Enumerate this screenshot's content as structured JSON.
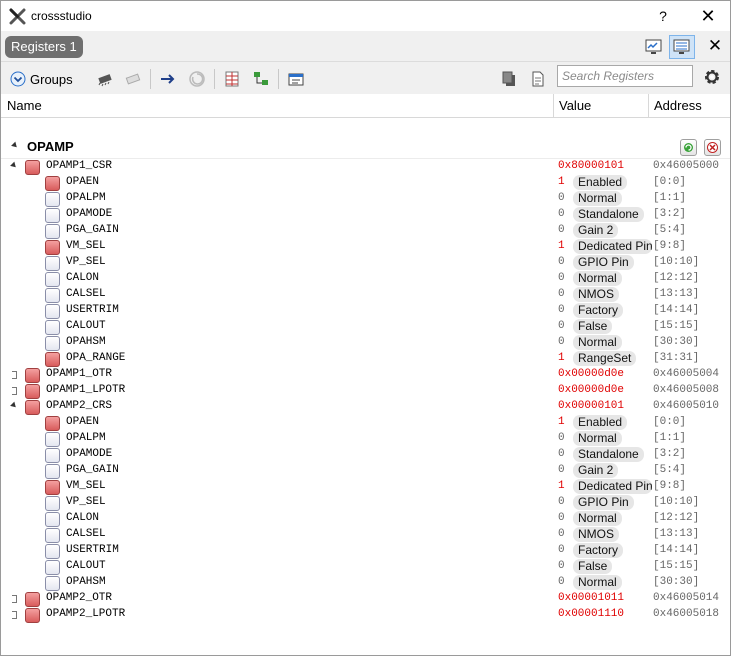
{
  "window": {
    "title": "crossstudio",
    "help_label": "?",
    "close_label": "✕"
  },
  "tabbar": {
    "tab_label": "Registers 1",
    "close_label": "✕"
  },
  "toolbar": {
    "groups_label": "Groups",
    "search_placeholder": "Search Registers"
  },
  "columns": {
    "name": "Name",
    "value": "Value",
    "address": "Address"
  },
  "group": {
    "name": "OPAMP"
  },
  "colors": {
    "register_value": "#e00000",
    "checked_box": "#d85c5c",
    "pill_bg": "#e6e6e6"
  },
  "rows": [
    {
      "level": 0,
      "expander": "open",
      "checked": true,
      "name": "OPAMP1_CSR",
      "value": "0x80000101",
      "value_color": "red",
      "field": "",
      "address": "0x46005000"
    },
    {
      "level": 1,
      "expander": "none",
      "checked": true,
      "name": "OPAEN",
      "value": "1",
      "value_color": "red",
      "field": "Enabled",
      "address": "[0:0]"
    },
    {
      "level": 1,
      "expander": "none",
      "checked": false,
      "name": "OPALPM",
      "value": "0",
      "value_color": "gray",
      "field": "Normal",
      "address": "[1:1]"
    },
    {
      "level": 1,
      "expander": "none",
      "checked": false,
      "name": "OPAMODE",
      "value": "0",
      "value_color": "gray",
      "field": "Standalone",
      "address": "[3:2]"
    },
    {
      "level": 1,
      "expander": "none",
      "checked": false,
      "name": "PGA_GAIN",
      "value": "0",
      "value_color": "gray",
      "field": "Gain 2",
      "address": "[5:4]"
    },
    {
      "level": 1,
      "expander": "none",
      "checked": true,
      "name": "VM_SEL",
      "value": "1",
      "value_color": "red",
      "field": "Dedicated Pin",
      "address": "[9:8]"
    },
    {
      "level": 1,
      "expander": "none",
      "checked": false,
      "name": "VP_SEL",
      "value": "0",
      "value_color": "gray",
      "field": "GPIO Pin",
      "address": "[10:10]"
    },
    {
      "level": 1,
      "expander": "none",
      "checked": false,
      "name": "CALON",
      "value": "0",
      "value_color": "gray",
      "field": "Normal",
      "address": "[12:12]"
    },
    {
      "level": 1,
      "expander": "none",
      "checked": false,
      "name": "CALSEL",
      "value": "0",
      "value_color": "gray",
      "field": "NMOS",
      "address": "[13:13]"
    },
    {
      "level": 1,
      "expander": "none",
      "checked": false,
      "name": "USERTRIM",
      "value": "0",
      "value_color": "gray",
      "field": "Factory",
      "address": "[14:14]"
    },
    {
      "level": 1,
      "expander": "none",
      "checked": false,
      "name": "CALOUT",
      "value": "0",
      "value_color": "gray",
      "field": "False",
      "address": "[15:15]"
    },
    {
      "level": 1,
      "expander": "none",
      "checked": false,
      "name": "OPAHSM",
      "value": "0",
      "value_color": "gray",
      "field": "Normal",
      "address": "[30:30]"
    },
    {
      "level": 1,
      "expander": "none",
      "checked": true,
      "name": "OPA_RANGE",
      "value": "1",
      "value_color": "red",
      "field": "RangeSet",
      "address": "[31:31]"
    },
    {
      "level": 0,
      "expander": "closed",
      "checked": true,
      "name": "OPAMP1_OTR",
      "value": "0x00000d0e",
      "value_color": "red",
      "field": "",
      "address": "0x46005004"
    },
    {
      "level": 0,
      "expander": "closed",
      "checked": true,
      "name": "OPAMP1_LPOTR",
      "value": "0x00000d0e",
      "value_color": "red",
      "field": "",
      "address": "0x46005008"
    },
    {
      "level": 0,
      "expander": "open",
      "checked": true,
      "name": "OPAMP2_CRS",
      "value": "0x00000101",
      "value_color": "red",
      "field": "",
      "address": "0x46005010"
    },
    {
      "level": 1,
      "expander": "none",
      "checked": true,
      "name": "OPAEN",
      "value": "1",
      "value_color": "red",
      "field": "Enabled",
      "address": "[0:0]"
    },
    {
      "level": 1,
      "expander": "none",
      "checked": false,
      "name": "OPALPM",
      "value": "0",
      "value_color": "gray",
      "field": "Normal",
      "address": "[1:1]"
    },
    {
      "level": 1,
      "expander": "none",
      "checked": false,
      "name": "OPAMODE",
      "value": "0",
      "value_color": "gray",
      "field": "Standalone",
      "address": "[3:2]"
    },
    {
      "level": 1,
      "expander": "none",
      "checked": false,
      "name": "PGA_GAIN",
      "value": "0",
      "value_color": "gray",
      "field": "Gain 2",
      "address": "[5:4]"
    },
    {
      "level": 1,
      "expander": "none",
      "checked": true,
      "name": "VM_SEL",
      "value": "1",
      "value_color": "red",
      "field": "Dedicated Pin",
      "address": "[9:8]"
    },
    {
      "level": 1,
      "expander": "none",
      "checked": false,
      "name": "VP_SEL",
      "value": "0",
      "value_color": "gray",
      "field": "GPIO Pin",
      "address": "[10:10]"
    },
    {
      "level": 1,
      "expander": "none",
      "checked": false,
      "name": "CALON",
      "value": "0",
      "value_color": "gray",
      "field": "Normal",
      "address": "[12:12]"
    },
    {
      "level": 1,
      "expander": "none",
      "checked": false,
      "name": "CALSEL",
      "value": "0",
      "value_color": "gray",
      "field": "NMOS",
      "address": "[13:13]"
    },
    {
      "level": 1,
      "expander": "none",
      "checked": false,
      "name": "USERTRIM",
      "value": "0",
      "value_color": "gray",
      "field": "Factory",
      "address": "[14:14]"
    },
    {
      "level": 1,
      "expander": "none",
      "checked": false,
      "name": "CALOUT",
      "value": "0",
      "value_color": "gray",
      "field": "False",
      "address": "[15:15]"
    },
    {
      "level": 1,
      "expander": "none",
      "checked": false,
      "name": "OPAHSM",
      "value": "0",
      "value_color": "gray",
      "field": "Normal",
      "address": "[30:30]"
    },
    {
      "level": 0,
      "expander": "closed",
      "checked": true,
      "name": "OPAMP2_OTR",
      "value": "0x00001011",
      "value_color": "red",
      "field": "",
      "address": "0x46005014"
    },
    {
      "level": 0,
      "expander": "closed",
      "checked": true,
      "name": "OPAMP2_LPOTR",
      "value": "0x00001110",
      "value_color": "red",
      "field": "",
      "address": "0x46005018"
    }
  ]
}
